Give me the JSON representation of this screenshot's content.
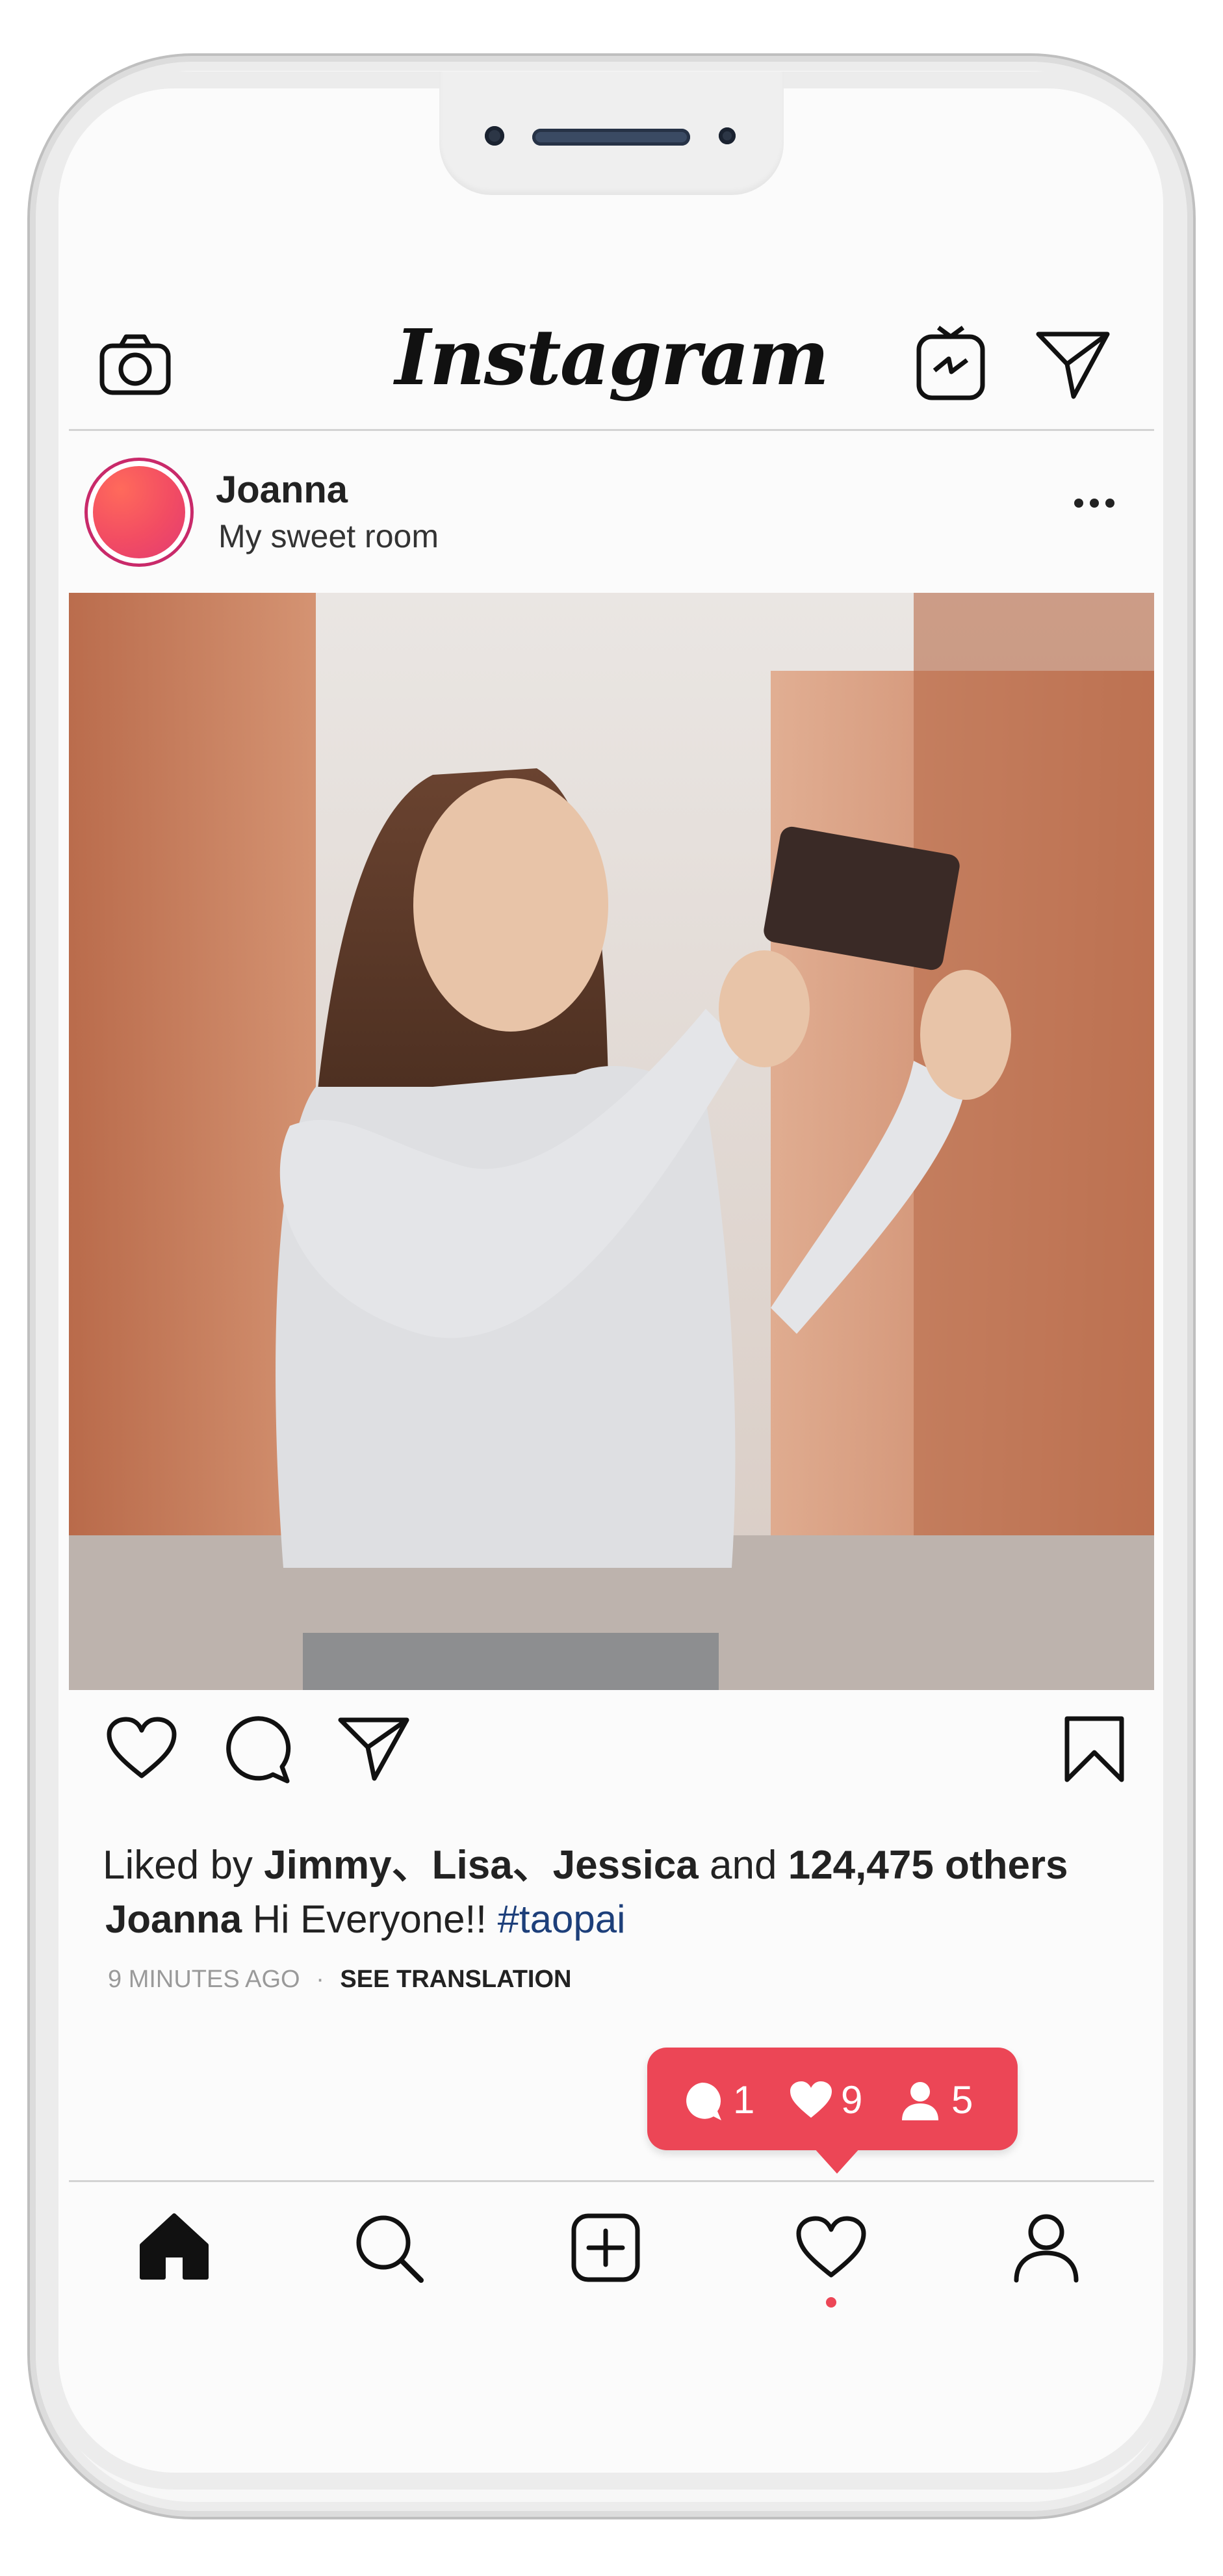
{
  "app": {
    "logo_text": "Instagram"
  },
  "topbar": {
    "left_icon": "camera-icon",
    "right_icons": [
      "igtv-icon",
      "direct-send-icon"
    ]
  },
  "post": {
    "username": "Joanna",
    "subtitle": "My sweet room",
    "more_icon": "more-dots-icon",
    "likes": {
      "prefix": "Liked by",
      "names": "Jimmy、Lisa、Jessica",
      "and": "and",
      "others": "124,475 others"
    },
    "caption": {
      "username": "Joanna",
      "text": "Hi Everyone!!",
      "hashtag": "#taopai"
    },
    "time": "9 MINUTES AGO",
    "separator": "·",
    "see_translation": "SEE TRANSLATION"
  },
  "actions": [
    "like-heart-icon",
    "comment-bubble-icon",
    "share-send-icon",
    "bookmark-icon"
  ],
  "notifications": {
    "comments": "1",
    "likes": "9",
    "follows": "5"
  },
  "bottom_nav": [
    "home-icon",
    "search-icon",
    "add-post-icon",
    "activity-heart-icon",
    "profile-icon"
  ],
  "colors": {
    "accent": "#ec4656",
    "hashtag": "#1d3f7a",
    "avatar_ring": "#c92a6a",
    "text": "#222222",
    "muted": "#9a9a9a"
  }
}
